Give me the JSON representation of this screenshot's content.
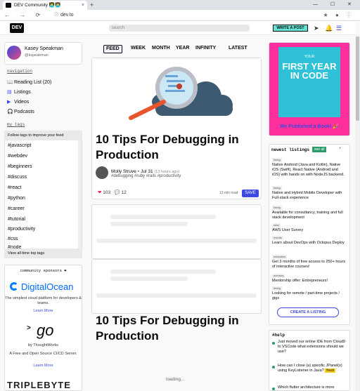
{
  "browser": {
    "tab_title": "DEV Community 👩‍💻👨‍💻",
    "tab_close": "×",
    "new_tab": "+",
    "window_controls": "— ☐ ✕",
    "nav_icons": "← → ⟳",
    "lock": "ⓘ",
    "url": "dev.to",
    "extensions": "★ ● ⋮"
  },
  "header": {
    "logo": "DEV",
    "search_placeholder": "search",
    "write_button": "WRITE A POST",
    "icons": [
      "send-icon",
      "bell-icon",
      "menu-avatar-icon"
    ]
  },
  "profile": {
    "name": "Kasey Speakman",
    "handle": "@kspeakman"
  },
  "nav": {
    "label": "navigation",
    "items": [
      {
        "icon": "📖",
        "label": "Reading List (20)"
      },
      {
        "icon": "▤",
        "label": "Listings"
      },
      {
        "icon": "▶",
        "label": "Videos"
      },
      {
        "icon": "🎧",
        "label": "Podcasts"
      }
    ]
  },
  "tags": {
    "label": "my tags",
    "header": "Follow tags to improve your feed",
    "items": [
      "#javascript",
      "#webdev",
      "#beginners",
      "#discuss",
      "#react",
      "#python",
      "#career",
      "#tutorial",
      "#productivity",
      "#css",
      "#node"
    ],
    "footer": "View all-time top tags"
  },
  "sponsors": {
    "heading": "community sponsors ❤",
    "digitalocean": {
      "name": "DigitalOcean",
      "desc": "The simplest cloud platform for developers & teams.",
      "link": "Learn More"
    },
    "gocd": {
      "name": "go",
      "by": "by ThoughtWorks",
      "desc": "A Free and Open Source CI/CD Server.",
      "link": "Learn More"
    },
    "triplebyte": {
      "name": "TRIPLEBYTE"
    }
  },
  "feed_tabs": [
    "FEED",
    "WEEK",
    "MONTH",
    "YEAR",
    "INFINITY",
    "LATEST"
  ],
  "article": {
    "title": "10 Tips For Debugging in Production",
    "author": "Molly Struve",
    "date": "・Jul 31",
    "ago": "(13 hours ago)",
    "tags": "#debugging #ruby #rails #productivity",
    "reactions": "103",
    "comments": "12",
    "read_time": "13 min read",
    "save": "SAVE",
    "heart_icon": "❤",
    "comment_icon": "💬"
  },
  "second_title": "10 Tips For Debugging in Production",
  "loading": "loading...",
  "book": {
    "sub": "YOUR",
    "title": "FIRST YEAR IN CODE",
    "published": "We Published a Book! 🎉"
  },
  "listings": {
    "heading": "newest listings",
    "badge": "see all",
    "plus": "+",
    "items": [
      {
        "cat": "hiring",
        "title": "Native Android (Java and Kotlin), Native iOS (Swift), React Native (Android and iOS) with hands on with NodeJS backend."
      },
      {
        "cat": "hiring",
        "title": "Native and Hybrid Mobile Developer with Full-stack experience"
      },
      {
        "cat": "hiring",
        "title": "Available for consultancy, training and full stack development"
      },
      {
        "cat": "misc",
        "title": "AWS User Survey"
      },
      {
        "cat": "events",
        "title": "Learn about DevOps with Octopus Deploy"
      },
      {
        "cat": "education",
        "title": "Get 3 months of free access to 250+ hours of interactive courses!"
      },
      {
        "cat": "mentors",
        "title": "Mentorship offer: Entrepreneurs!"
      },
      {
        "cat": "hiring",
        "title": "Looking for remote / part-time projects / gigs"
      }
    ],
    "create": "CREATE A LISTING"
  },
  "help": {
    "heading": "#help",
    "items": [
      {
        "text": "Just moved our online IDE from Cloud9 to VSCode what extensions should we use?"
      },
      {
        "text": "How can I close (a) specific JPanel(s) using KeyListener in Java?",
        "badge": "fresh"
      },
      {
        "text": "Which flutter architecture is more"
      }
    ]
  }
}
